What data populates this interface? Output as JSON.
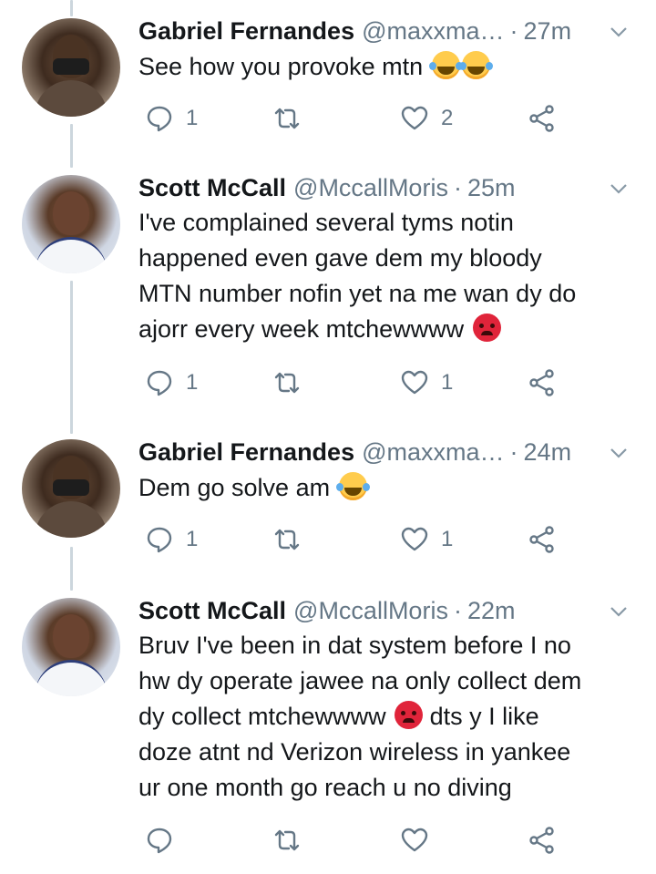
{
  "tweets": [
    {
      "author": "Gabriel Fernandes",
      "handle": "@maxxma…",
      "separator": "·",
      "time": "27m",
      "text": "See how you provoke mtn",
      "emojis": [
        "face-with-tears-of-joy",
        "face-with-tears-of-joy"
      ],
      "replies": "1",
      "retweets": "",
      "likes": "2"
    },
    {
      "author": "Scott McCall",
      "handle": "@MccallMoris",
      "separator": "·",
      "time": "25m",
      "text_lines": [
        "I've complained several tyms notin",
        "happened even gave dem my bloody",
        "MTN number nofin yet na me wan dy do",
        "ajorr every week mtchewwww"
      ],
      "emojis": [
        "pouting-face"
      ],
      "replies": "1",
      "retweets": "",
      "likes": "1"
    },
    {
      "author": "Gabriel Fernandes",
      "handle": "@maxxma…",
      "separator": "·",
      "time": "24m",
      "text": "Dem go solve am",
      "emojis": [
        "face-with-tears-of-joy"
      ],
      "replies": "1",
      "retweets": "",
      "likes": "1"
    },
    {
      "author": "Scott McCall",
      "handle": "@MccallMoris",
      "separator": "·",
      "time": "22m",
      "text_lines": [
        "Bruv I've been in dat system before I no",
        "hw dy operate jawee na only collect dem",
        "dy collect mtchewwww",
        " dts y I like",
        "doze atnt nd Verizon wireless in yankee",
        "ur one month go reach u no diving"
      ],
      "emojis": [
        "pouting-face"
      ],
      "replies": "",
      "retweets": "",
      "likes": ""
    }
  ],
  "colors": {
    "text": "#14171a",
    "secondary": "#657786",
    "thread_line": "#ccd6dd"
  },
  "icons": [
    "reply-icon",
    "retweet-icon",
    "like-icon",
    "share-icon",
    "chevron-down-icon"
  ]
}
